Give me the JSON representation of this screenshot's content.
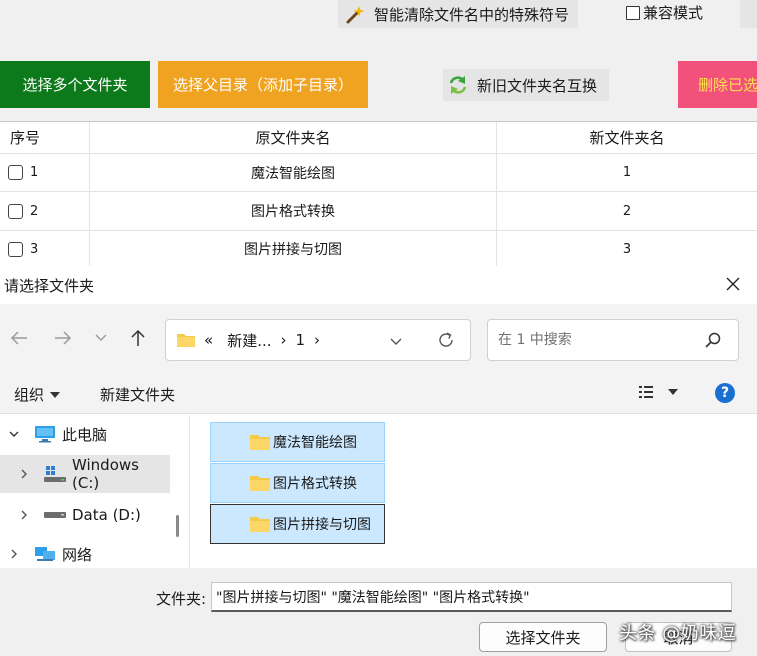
{
  "app": {
    "clean_button_label": "智能清除文件名中的特殊符号",
    "compat_mode_label": "兼容模式",
    "compat_mode_checked": false,
    "buttons": {
      "select_multi": "选择多个文件夹",
      "select_parent": "选择父目录（添加子目录）",
      "swap_names": "新旧文件夹名互换",
      "delete_selected": "删除已选"
    },
    "colors": {
      "green": "#0c7a1a",
      "orange": "#f0a321",
      "pink": "#f2517c",
      "pink_text": "#ffe14d"
    },
    "table": {
      "headers": [
        "序号",
        "原文件夹名",
        "新文件夹名"
      ],
      "rows": [
        {
          "index": "1",
          "old_name": "魔法智能绘图",
          "new_name": "1",
          "checked": false
        },
        {
          "index": "2",
          "old_name": "图片格式转换",
          "new_name": "2",
          "checked": false
        },
        {
          "index": "3",
          "old_name": "图片拼接与切图",
          "new_name": "3",
          "checked": false
        }
      ]
    }
  },
  "dialog": {
    "title": "请选择文件夹",
    "address": {
      "prefix": "«",
      "crumb_1": "新建...",
      "crumb_2": "1",
      "sep": "›"
    },
    "search_placeholder": "在 1 中搜索",
    "toolbar": {
      "organize": "组织",
      "new_folder": "新建文件夹",
      "help": "?"
    },
    "tree": [
      {
        "label": "此电脑",
        "icon": "computer-icon",
        "expanded": true
      },
      {
        "label": "Windows (C:)",
        "icon": "windows-drive-icon",
        "selected": true
      },
      {
        "label": "Data (D:)",
        "icon": "drive-icon"
      },
      {
        "label": "网络",
        "icon": "network-icon"
      }
    ],
    "folders": [
      {
        "name": "魔法智能绘图"
      },
      {
        "name": "图片格式转换"
      },
      {
        "name": "图片拼接与切图"
      }
    ],
    "filename_label": "文件夹:",
    "filename_value": "\"图片拼接与切图\" \"魔法智能绘图\" \"图片格式转换\"",
    "ok_label": "选择文件夹",
    "cancel_label": "取消",
    "accent": "#1a6fd0",
    "selection_fill": "#cce8ff"
  },
  "watermark": "头条 @奶味逗"
}
